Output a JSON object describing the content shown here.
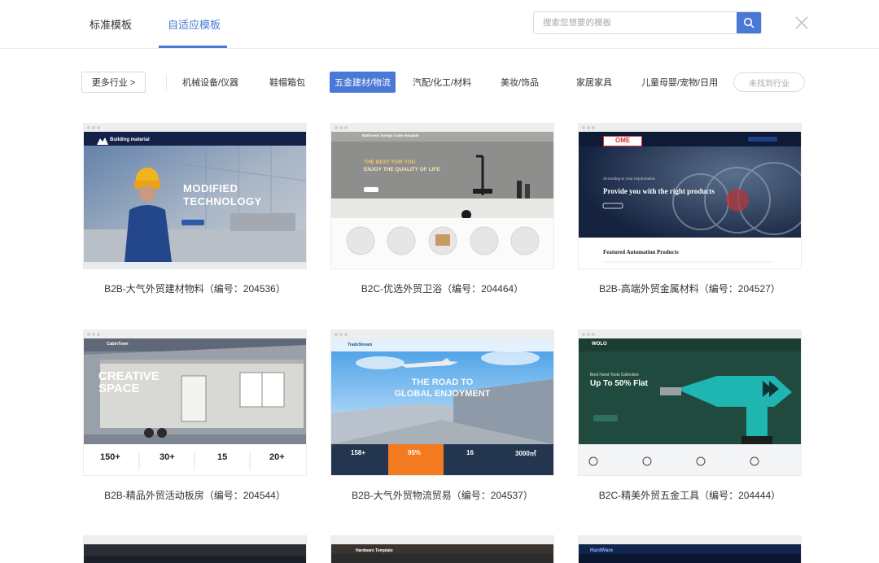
{
  "header": {
    "tabs": [
      {
        "label": "标准模板",
        "active": false
      },
      {
        "label": "自适应模板",
        "active": true
      }
    ],
    "search": {
      "placeholder": "搜索您想要的模板"
    },
    "accent_color": "#4a78d6"
  },
  "filters": {
    "more_label": "更多行业 >",
    "categories": [
      {
        "label": "机械设备/仪器",
        "active": false
      },
      {
        "label": "鞋帽箱包",
        "active": false
      },
      {
        "label": "五金建材/物流",
        "active": true
      },
      {
        "label": "汽配/化工/材料",
        "active": false
      },
      {
        "label": "美妆/饰品",
        "active": false
      },
      {
        "label": "家居家具",
        "active": false
      },
      {
        "label": "儿童母婴/宠物/日用",
        "active": false
      }
    ],
    "not_found_label": "未找到行业"
  },
  "templates": [
    {
      "caption": "B2B-大气外贸建材物料（编号：204536）",
      "preview": {
        "brand": "Building material",
        "headline_1": "MODIFIED",
        "headline_2": "TECHNOLOGY"
      }
    },
    {
      "caption": "B2C-优选外贸卫浴（编号：204464）",
      "preview": {
        "brand": "Bathroom foreign trade template",
        "headline_1": "THE BEST FOR YOU",
        "headline_2": "ENJOY THE QUALITY OF LIFE"
      }
    },
    {
      "caption": "B2B-高端外贸金属材料（编号：204527）",
      "preview": {
        "brand": "OME",
        "headline_1": "According to your requirements",
        "headline_2": "Provide you with the right products",
        "section": "Featured Automation Products"
      }
    },
    {
      "caption": "B2B-精品外贸活动板房（编号：204544）",
      "preview": {
        "brand": "CabinTown",
        "headline_1": "CREATIVE",
        "headline_2": "SPACE",
        "stats": [
          "150+",
          "30+",
          "15",
          "20+"
        ]
      }
    },
    {
      "caption": "B2B-大气外贸物流贸易（编号：204537）",
      "preview": {
        "brand": "TradeStream",
        "headline_1": "THE ROAD TO",
        "headline_2": "GLOBAL ENJOYMENT",
        "stats": [
          "158+",
          "95%",
          "16",
          "3000㎡"
        ]
      }
    },
    {
      "caption": "B2C-精美外贸五金工具（编号：204444）",
      "preview": {
        "brand": "WOLO",
        "headline_1": "Best Hand Tools Collection",
        "headline_2": "Up To 50% Flat"
      }
    }
  ],
  "partial_row": [
    {
      "brand": ""
    },
    {
      "brand": "Hardware Template"
    },
    {
      "brand": "HardWare"
    }
  ]
}
